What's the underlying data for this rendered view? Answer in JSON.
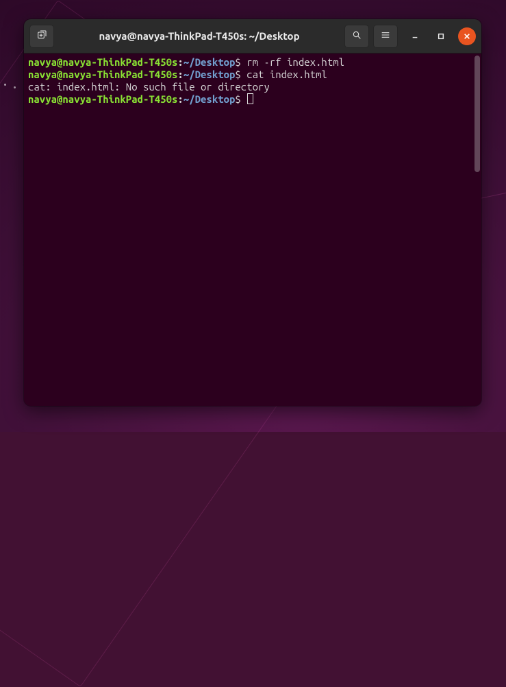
{
  "window": {
    "title": "navya@navya-ThinkPad-T450s: ~/Desktop"
  },
  "prompt": {
    "user_host": "navya@navya-ThinkPad-T450s",
    "colon": ":",
    "path": "~/Desktop",
    "dollar": "$ "
  },
  "lines": [
    {
      "type": "cmd",
      "text": "rm -rf index.html"
    },
    {
      "type": "cmd",
      "text": "cat index.html"
    },
    {
      "type": "out",
      "text": "cat: index.html: No such file or directory"
    },
    {
      "type": "cmd",
      "text": ""
    }
  ],
  "icons": {
    "new_tab": "new-tab-icon",
    "search": "search-icon",
    "menu": "hamburger-icon",
    "minimize": "minimize-icon",
    "maximize": "maximize-icon",
    "close": "close-icon"
  }
}
